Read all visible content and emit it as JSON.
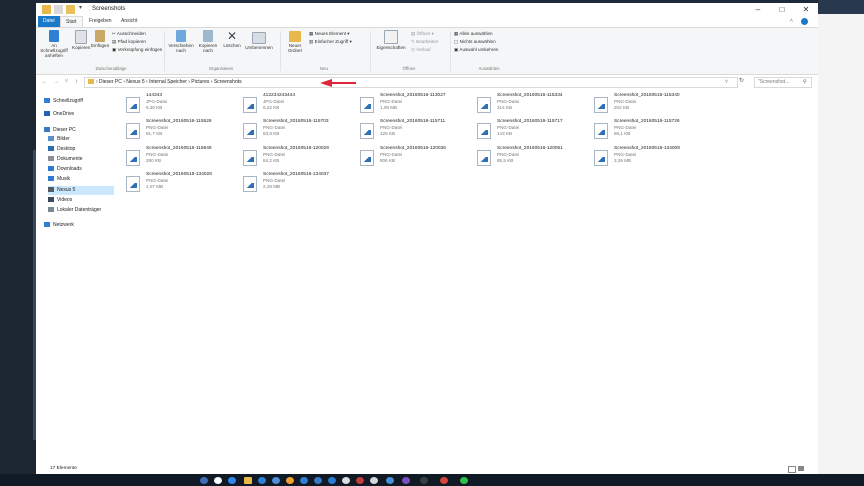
{
  "window": {
    "title": "Screenshots",
    "controls": {
      "minimize": "–",
      "maximize": "□",
      "close": "✕"
    }
  },
  "tabs": [
    "Datei",
    "Start",
    "Freigeben",
    "Ansicht"
  ],
  "ribbon": {
    "clipboard": {
      "pin": "An Schnellzugriff anheften",
      "copy": "Kopieren",
      "paste": "Einfügen",
      "cut": "Ausschneiden",
      "copy_path": "Pfad kopieren",
      "paste_shortcut": "Verknüpfung einfügen",
      "group": "Zwischenablage"
    },
    "organize": {
      "move": "Verschieben nach",
      "copy_to": "Kopieren nach",
      "delete": "Löschen",
      "rename": "Umbenennen",
      "group": "Organisieren"
    },
    "new": {
      "new_folder": "Neuer Ordner",
      "new_item": "Neues Element ▾",
      "easy_access": "Einfacher Zugriff ▾",
      "group": "Neu"
    },
    "open": {
      "properties": "Eigenschaften",
      "open": "Öffnen ▾",
      "edit": "Bearbeiten",
      "history": "Verlauf",
      "group": "Öffnen"
    },
    "select": {
      "select_all": "Alles auswählen",
      "select_none": "Nichts auswählen",
      "invert": "Auswahl umkehren",
      "group": "Auswählen"
    }
  },
  "address": {
    "path": "›  Dieser PC  ›  Nexus 5  ›  Internal Speicher  ›  Pictures  ›  Screenshots",
    "search_placeholder": "\"Screenshot... ",
    "nav_back": "←",
    "nav_forward": "→",
    "nav_up": "↑"
  },
  "nav_pane": [
    {
      "label": "Schnellzugriff",
      "color": "#2f7fd4"
    },
    {
      "label": "OneDrive",
      "color": "#1e63b8"
    },
    {
      "label": "Dieser PC",
      "color": "#3a78c2"
    },
    {
      "label": "Bilder",
      "color": "#5a8fcf"
    },
    {
      "label": "Desktop",
      "color": "#2c6cb4"
    },
    {
      "label": "Dokumente",
      "color": "#8a8f95"
    },
    {
      "label": "Downloads",
      "color": "#2b7bd0"
    },
    {
      "label": "Musik",
      "color": "#2b7bd0"
    },
    {
      "label": "Nexus 5",
      "color": "#555b63"
    },
    {
      "label": "Videos",
      "color": "#3b4a5c"
    },
    {
      "label": "Lokaler Datenträger",
      "color": "#7b8794"
    },
    {
      "label": "Netzwerk",
      "color": "#2f7fd4"
    }
  ],
  "files": [
    {
      "name": "144343",
      "type": "JPG-Datei",
      "size": "6,30 KB"
    },
    {
      "name": "412234243444",
      "type": "JPG-Datei",
      "size": "6,22 KB"
    },
    {
      "name": "Screenshot_20160516-113027",
      "type": "PNG-Datei",
      "size": "1,08 MB"
    },
    {
      "name": "Screenshot_20160516-115334",
      "type": "PNG-Datei",
      "size": "314 KB"
    },
    {
      "name": "Screenshot_20160516-115340",
      "type": "PNG-Datei",
      "size": "202 KB"
    },
    {
      "name": "Screenshot_20160516-115526",
      "type": "PNG-Datei",
      "size": "91,7 KB"
    },
    {
      "name": "Screenshot_20160516-115703",
      "type": "PNG-Datei",
      "size": "83,8 KB"
    },
    {
      "name": "Screenshot_20160516-115711",
      "type": "PNG-Datei",
      "size": "125 KB"
    },
    {
      "name": "Screenshot_20160516-115717",
      "type": "PNG-Datei",
      "size": "143 KB"
    },
    {
      "name": "Screenshot_20160516-115726",
      "type": "PNG-Datei",
      "size": "86,1 KB"
    },
    {
      "name": "Screenshot_20160516-115949",
      "type": "PNG-Datei",
      "size": "280 KB"
    },
    {
      "name": "Screenshot_20160516-120029",
      "type": "PNG-Datei",
      "size": "84,2 KB"
    },
    {
      "name": "Screenshot_20160516-120036",
      "type": "PNG-Datei",
      "size": "806 KB"
    },
    {
      "name": "Screenshot_20160516-120051",
      "type": "PNG-Datei",
      "size": "85,5 KB"
    },
    {
      "name": "Screenshot_20160516-134008",
      "type": "PNG-Datei",
      "size": "3,26 MB"
    },
    {
      "name": "Screenshot_20160516-134028",
      "type": "PNG-Datei",
      "size": "1,07 MB"
    },
    {
      "name": "Screenshot_20160516-134037",
      "type": "PNG-Datei",
      "size": "2,28 MB"
    }
  ],
  "status": {
    "item_count": "17 Elemente"
  },
  "accent_color": "#1979ca"
}
